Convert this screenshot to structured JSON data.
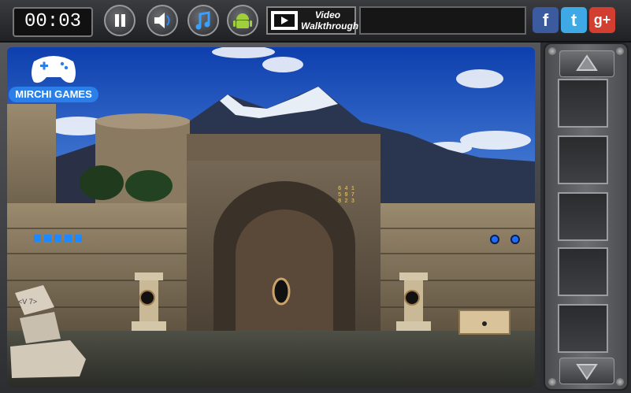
{
  "toolbar": {
    "timer": "00:03",
    "walkthrough_line1": "Video",
    "walkthrough_line2": "Walkthrough",
    "social_facebook": "f",
    "social_twitter": "t",
    "social_google": "g+"
  },
  "logo": {
    "text": "MIRCHI GAMES"
  },
  "scene": {
    "code_rows": [
      "6 4 1",
      "5 9 7",
      "8 2 3"
    ],
    "rock_clue": "<V 7>",
    "blue_squares": 5,
    "blue_dots": 2
  },
  "inventory": {
    "slots": 5
  },
  "colors": {
    "accent_blue": "#1e88ff",
    "sky": "#1b55c8",
    "stone": "#8a7a60"
  },
  "icons": [
    "pause-icon",
    "sound-icon",
    "music-icon",
    "android-icon",
    "film-icon",
    "arrow-up-icon",
    "arrow-down-icon"
  ]
}
